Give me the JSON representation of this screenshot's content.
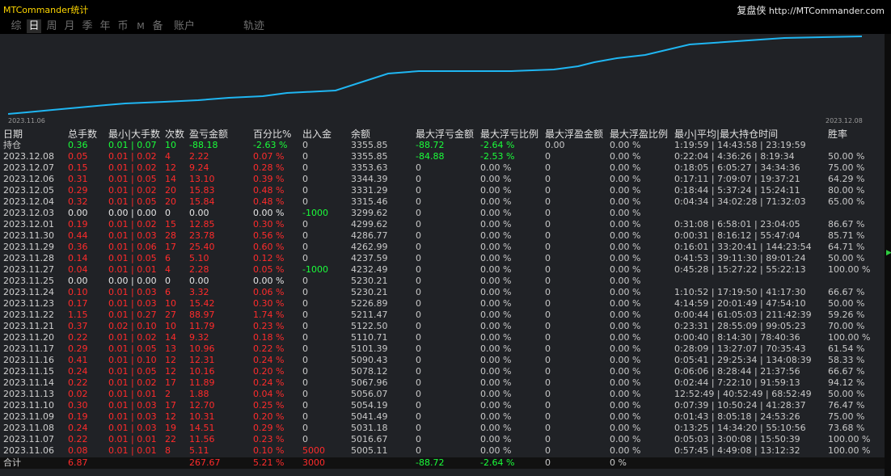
{
  "app": {
    "title": "MTCommander统计"
  },
  "brand": {
    "name": "复盘侠",
    "url": "http://MTCommander.com"
  },
  "tabs": [
    "综",
    "日",
    "周",
    "月",
    "季",
    "年",
    "币",
    "M",
    "备",
    "账户",
    "轨迹"
  ],
  "active_tab": "日",
  "colors": {
    "background": "#000000",
    "panel": "#202226",
    "line": "#1fb6f2",
    "profit": "#1aff3a",
    "loss": "#ff2b2b",
    "title": "#ffd700"
  },
  "chart_data": {
    "type": "line",
    "title": "",
    "x": [
      "2023.11.06",
      "2023.11.07",
      "2023.11.08",
      "2023.11.09",
      "2023.11.10",
      "2023.11.13",
      "2023.11.14",
      "2023.11.15",
      "2023.11.16",
      "2023.11.17",
      "2023.11.20",
      "2023.11.21",
      "2023.11.22",
      "2023.11.23",
      "2023.11.24",
      "2023.11.25",
      "2023.11.27",
      "2023.11.28",
      "2023.11.29",
      "2023.11.30",
      "2023.12.01",
      "2023.12.03",
      "2023.12.04",
      "2023.12.05",
      "2023.12.06",
      "2023.12.07",
      "2023.12.08"
    ],
    "series": [
      {
        "values": [
          5005.11,
          5016.67,
          5031.18,
          5041.49,
          5054.19,
          5056.07,
          5067.96,
          5078.12,
          5090.43,
          5101.39,
          5110.71,
          5122.5,
          5211.47,
          5226.89,
          5230.21,
          5230.21,
          5232.49,
          5237.59,
          5262.99,
          5286.77,
          5299.62,
          5299.62,
          5315.46,
          5331.29,
          5344.39,
          5353.63,
          5355.85
        ]
      }
    ],
    "x_start_label": "2023.11.06",
    "x_end_label": "2023.12.08",
    "grid": false
  },
  "table": {
    "headers": [
      "日期",
      "总手数",
      "最小|大手数",
      "次数",
      "盈亏金额",
      "百分比%",
      "出入金",
      "余额",
      "最大浮亏金额",
      "最大浮亏比例",
      "最大浮盈金额",
      "最大浮盈比例",
      "最小|平均|最大持仓时间",
      "胜率"
    ],
    "holding": {
      "date": "持仓",
      "lots": "0.36",
      "minmax": "0.01 | 0.07",
      "count": "10",
      "pnl": "-88.18",
      "pct": "-2.63 %",
      "io": "0",
      "balance": "3355.85",
      "max_float_loss": "-88.72",
      "max_float_loss_pct": "-2.64 %",
      "max_float_profit": "0.00",
      "max_float_profit_pct": "0.00 %",
      "hold_time": "1:19:59 | 14:43:58 | 23:19:59",
      "winrate": ""
    },
    "rows": [
      {
        "date": "2023.12.08",
        "lots": "0.05",
        "minmax": "0.01 | 0.02",
        "count": "4",
        "pnl": "2.22",
        "pct": "0.07 %",
        "io": "0",
        "balance": "3355.85",
        "max_float_loss": "-84.88",
        "max_float_loss_pct": "-2.53 %",
        "max_float_profit": "0",
        "max_float_profit_pct": "0.00 %",
        "hold_time": "0:22:04 | 4:36:26 | 8:19:34",
        "winrate": "50.00 %"
      },
      {
        "date": "2023.12.07",
        "lots": "0.15",
        "minmax": "0.01 | 0.02",
        "count": "12",
        "pnl": "9.24",
        "pct": "0.28 %",
        "io": "0",
        "balance": "3353.63",
        "max_float_loss": "0",
        "max_float_loss_pct": "0.00 %",
        "max_float_profit": "0",
        "max_float_profit_pct": "0.00 %",
        "hold_time": "0:18:05 | 6:05:27 | 34:34:36",
        "winrate": "75.00 %"
      },
      {
        "date": "2023.12.06",
        "lots": "0.31",
        "minmax": "0.01 | 0.05",
        "count": "14",
        "pnl": "13.10",
        "pct": "0.39 %",
        "io": "0",
        "balance": "3344.39",
        "max_float_loss": "0",
        "max_float_loss_pct": "0.00 %",
        "max_float_profit": "0",
        "max_float_profit_pct": "0.00 %",
        "hold_time": "0:17:11 | 7:09:07 | 19:37:21",
        "winrate": "64.29 %"
      },
      {
        "date": "2023.12.05",
        "lots": "0.29",
        "minmax": "0.01 | 0.02",
        "count": "20",
        "pnl": "15.83",
        "pct": "0.48 %",
        "io": "0",
        "balance": "3331.29",
        "max_float_loss": "0",
        "max_float_loss_pct": "0.00 %",
        "max_float_profit": "0",
        "max_float_profit_pct": "0.00 %",
        "hold_time": "0:18:44 | 5:37:24 | 15:24:11",
        "winrate": "80.00 %"
      },
      {
        "date": "2023.12.04",
        "lots": "0.32",
        "minmax": "0.01 | 0.05",
        "count": "20",
        "pnl": "15.84",
        "pct": "0.48 %",
        "io": "0",
        "balance": "3315.46",
        "max_float_loss": "0",
        "max_float_loss_pct": "0.00 %",
        "max_float_profit": "0",
        "max_float_profit_pct": "0.00 %",
        "hold_time": "0:04:34 | 34:02:28 | 71:32:03",
        "winrate": "65.00 %"
      },
      {
        "date": "2023.12.03",
        "lots": "0.00",
        "minmax": "0.00 | 0.00",
        "count": "0",
        "pnl": "0.00",
        "pct": "0.00 %",
        "io": "-1000",
        "balance": "3299.62",
        "max_float_loss": "0",
        "max_float_loss_pct": "0.00 %",
        "max_float_profit": "0",
        "max_float_profit_pct": "0.00 %",
        "hold_time": "",
        "winrate": ""
      },
      {
        "date": "2023.12.01",
        "lots": "0.19",
        "minmax": "0.01 | 0.02",
        "count": "15",
        "pnl": "12.85",
        "pct": "0.30 %",
        "io": "0",
        "balance": "4299.62",
        "max_float_loss": "0",
        "max_float_loss_pct": "0.00 %",
        "max_float_profit": "0",
        "max_float_profit_pct": "0.00 %",
        "hold_time": "0:31:08 | 6:58:01 | 23:04:05",
        "winrate": "86.67 %"
      },
      {
        "date": "2023.11.30",
        "lots": "0.44",
        "minmax": "0.01 | 0.03",
        "count": "28",
        "pnl": "23.78",
        "pct": "0.56 %",
        "io": "0",
        "balance": "4286.77",
        "max_float_loss": "0",
        "max_float_loss_pct": "0.00 %",
        "max_float_profit": "0",
        "max_float_profit_pct": "0.00 %",
        "hold_time": "0:00:31 | 8:16:12 | 55:47:04",
        "winrate": "85.71 %"
      },
      {
        "date": "2023.11.29",
        "lots": "0.36",
        "minmax": "0.01 | 0.06",
        "count": "17",
        "pnl": "25.40",
        "pct": "0.60 %",
        "io": "0",
        "balance": "4262.99",
        "max_float_loss": "0",
        "max_float_loss_pct": "0.00 %",
        "max_float_profit": "0",
        "max_float_profit_pct": "0.00 %",
        "hold_time": "0:16:01 | 33:20:41 | 144:23:54",
        "winrate": "64.71 %"
      },
      {
        "date": "2023.11.28",
        "lots": "0.14",
        "minmax": "0.01 | 0.05",
        "count": "6",
        "pnl": "5.10",
        "pct": "0.12 %",
        "io": "0",
        "balance": "4237.59",
        "max_float_loss": "0",
        "max_float_loss_pct": "0.00 %",
        "max_float_profit": "0",
        "max_float_profit_pct": "0.00 %",
        "hold_time": "0:41:53 | 39:11:30 | 89:01:24",
        "winrate": "50.00 %"
      },
      {
        "date": "2023.11.27",
        "lots": "0.04",
        "minmax": "0.01 | 0.01",
        "count": "4",
        "pnl": "2.28",
        "pct": "0.05 %",
        "io": "-1000",
        "balance": "4232.49",
        "max_float_loss": "0",
        "max_float_loss_pct": "0.00 %",
        "max_float_profit": "0",
        "max_float_profit_pct": "0.00 %",
        "hold_time": "0:45:28 | 15:27:22 | 55:22:13",
        "winrate": "100.00 %"
      },
      {
        "date": "2023.11.25",
        "lots": "0.00",
        "minmax": "0.00 | 0.00",
        "count": "0",
        "pnl": "0.00",
        "pct": "0.00 %",
        "io": "0",
        "balance": "5230.21",
        "max_float_loss": "0",
        "max_float_loss_pct": "0.00 %",
        "max_float_profit": "0",
        "max_float_profit_pct": "0.00 %",
        "hold_time": "",
        "winrate": ""
      },
      {
        "date": "2023.11.24",
        "lots": "0.10",
        "minmax": "0.01 | 0.03",
        "count": "6",
        "pnl": "3.32",
        "pct": "0.06 %",
        "io": "0",
        "balance": "5230.21",
        "max_float_loss": "0",
        "max_float_loss_pct": "0.00 %",
        "max_float_profit": "0",
        "max_float_profit_pct": "0.00 %",
        "hold_time": "1:10:52 | 17:19:50 | 41:17:30",
        "winrate": "66.67 %"
      },
      {
        "date": "2023.11.23",
        "lots": "0.17",
        "minmax": "0.01 | 0.03",
        "count": "10",
        "pnl": "15.42",
        "pct": "0.30 %",
        "io": "0",
        "balance": "5226.89",
        "max_float_loss": "0",
        "max_float_loss_pct": "0.00 %",
        "max_float_profit": "0",
        "max_float_profit_pct": "0.00 %",
        "hold_time": "4:14:59 | 20:01:49 | 47:54:10",
        "winrate": "50.00 %"
      },
      {
        "date": "2023.11.22",
        "lots": "1.15",
        "minmax": "0.01 | 0.27",
        "count": "27",
        "pnl": "88.97",
        "pct": "1.74 %",
        "io": "0",
        "balance": "5211.47",
        "max_float_loss": "0",
        "max_float_loss_pct": "0.00 %",
        "max_float_profit": "0",
        "max_float_profit_pct": "0.00 %",
        "hold_time": "0:00:44 | 61:05:03 | 211:42:39",
        "winrate": "59.26 %"
      },
      {
        "date": "2023.11.21",
        "lots": "0.37",
        "minmax": "0.02 | 0.10",
        "count": "10",
        "pnl": "11.79",
        "pct": "0.23 %",
        "io": "0",
        "balance": "5122.50",
        "max_float_loss": "0",
        "max_float_loss_pct": "0.00 %",
        "max_float_profit": "0",
        "max_float_profit_pct": "0.00 %",
        "hold_time": "0:23:31 | 28:55:09 | 99:05:23",
        "winrate": "70.00 %"
      },
      {
        "date": "2023.11.20",
        "lots": "0.22",
        "minmax": "0.01 | 0.02",
        "count": "14",
        "pnl": "9.32",
        "pct": "0.18 %",
        "io": "0",
        "balance": "5110.71",
        "max_float_loss": "0",
        "max_float_loss_pct": "0.00 %",
        "max_float_profit": "0",
        "max_float_profit_pct": "0.00 %",
        "hold_time": "0:00:40 | 8:14:30 | 78:40:36",
        "winrate": "100.00 %"
      },
      {
        "date": "2023.11.17",
        "lots": "0.29",
        "minmax": "0.01 | 0.05",
        "count": "13",
        "pnl": "10.96",
        "pct": "0.22 %",
        "io": "0",
        "balance": "5101.39",
        "max_float_loss": "0",
        "max_float_loss_pct": "0.00 %",
        "max_float_profit": "0",
        "max_float_profit_pct": "0.00 %",
        "hold_time": "0:28:09 | 13:27:07 | 70:35:43",
        "winrate": "61.54 %"
      },
      {
        "date": "2023.11.16",
        "lots": "0.41",
        "minmax": "0.01 | 0.10",
        "count": "12",
        "pnl": "12.31",
        "pct": "0.24 %",
        "io": "0",
        "balance": "5090.43",
        "max_float_loss": "0",
        "max_float_loss_pct": "0.00 %",
        "max_float_profit": "0",
        "max_float_profit_pct": "0.00 %",
        "hold_time": "0:05:41 | 29:25:34 | 134:08:39",
        "winrate": "58.33 %"
      },
      {
        "date": "2023.11.15",
        "lots": "0.24",
        "minmax": "0.01 | 0.05",
        "count": "12",
        "pnl": "10.16",
        "pct": "0.20 %",
        "io": "0",
        "balance": "5078.12",
        "max_float_loss": "0",
        "max_float_loss_pct": "0.00 %",
        "max_float_profit": "0",
        "max_float_profit_pct": "0.00 %",
        "hold_time": "0:06:06 | 8:28:44 | 21:37:56",
        "winrate": "66.67 %"
      },
      {
        "date": "2023.11.14",
        "lots": "0.22",
        "minmax": "0.01 | 0.02",
        "count": "17",
        "pnl": "11.89",
        "pct": "0.24 %",
        "io": "0",
        "balance": "5067.96",
        "max_float_loss": "0",
        "max_float_loss_pct": "0.00 %",
        "max_float_profit": "0",
        "max_float_profit_pct": "0.00 %",
        "hold_time": "0:02:44 | 7:22:10 | 91:59:13",
        "winrate": "94.12 %"
      },
      {
        "date": "2023.11.13",
        "lots": "0.02",
        "minmax": "0.01 | 0.01",
        "count": "2",
        "pnl": "1.88",
        "pct": "0.04 %",
        "io": "0",
        "balance": "5056.07",
        "max_float_loss": "0",
        "max_float_loss_pct": "0.00 %",
        "max_float_profit": "0",
        "max_float_profit_pct": "0.00 %",
        "hold_time": "12:52:49 | 40:52:49 | 68:52:49",
        "winrate": "50.00 %"
      },
      {
        "date": "2023.11.10",
        "lots": "0.30",
        "minmax": "0.01 | 0.03",
        "count": "17",
        "pnl": "12.70",
        "pct": "0.25 %",
        "io": "0",
        "balance": "5054.19",
        "max_float_loss": "0",
        "max_float_loss_pct": "0.00 %",
        "max_float_profit": "0",
        "max_float_profit_pct": "0.00 %",
        "hold_time": "0:07:39 | 10:50:24 | 41:28:37",
        "winrate": "76.47 %"
      },
      {
        "date": "2023.11.09",
        "lots": "0.19",
        "minmax": "0.01 | 0.03",
        "count": "12",
        "pnl": "10.31",
        "pct": "0.20 %",
        "io": "0",
        "balance": "5041.49",
        "max_float_loss": "0",
        "max_float_loss_pct": "0.00 %",
        "max_float_profit": "0",
        "max_float_profit_pct": "0.00 %",
        "hold_time": "0:01:43 | 8:05:18 | 24:53:26",
        "winrate": "75.00 %"
      },
      {
        "date": "2023.11.08",
        "lots": "0.24",
        "minmax": "0.01 | 0.03",
        "count": "19",
        "pnl": "14.51",
        "pct": "0.29 %",
        "io": "0",
        "balance": "5031.18",
        "max_float_loss": "0",
        "max_float_loss_pct": "0.00 %",
        "max_float_profit": "0",
        "max_float_profit_pct": "0.00 %",
        "hold_time": "0:13:25 | 14:34:20 | 55:10:56",
        "winrate": "73.68 %"
      },
      {
        "date": "2023.11.07",
        "lots": "0.22",
        "minmax": "0.01 | 0.01",
        "count": "22",
        "pnl": "11.56",
        "pct": "0.23 %",
        "io": "0",
        "balance": "5016.67",
        "max_float_loss": "0",
        "max_float_loss_pct": "0.00 %",
        "max_float_profit": "0",
        "max_float_profit_pct": "0.00 %",
        "hold_time": "0:05:03 | 3:00:08 | 15:50:39",
        "winrate": "100.00 %"
      },
      {
        "date": "2023.11.06",
        "lots": "0.08",
        "minmax": "0.01 | 0.01",
        "count": "8",
        "pnl": "5.11",
        "pct": "0.10 %",
        "io": "5000",
        "balance": "5005.11",
        "max_float_loss": "0",
        "max_float_loss_pct": "0.00 %",
        "max_float_profit": "0",
        "max_float_profit_pct": "0.00 %",
        "hold_time": "0:57:45 | 4:49:08 | 13:12:32",
        "winrate": "100.00 %"
      }
    ],
    "total": {
      "date": "合计",
      "lots": "6.87",
      "minmax": "",
      "count": "",
      "pnl": "267.67",
      "pct": "5.21 %",
      "io": "3000",
      "balance": "",
      "max_float_loss": "-88.72",
      "max_float_loss_pct": "-2.64 %",
      "max_float_profit": "0",
      "max_float_profit_pct": "0 %",
      "hold_time": "",
      "winrate": ""
    }
  }
}
